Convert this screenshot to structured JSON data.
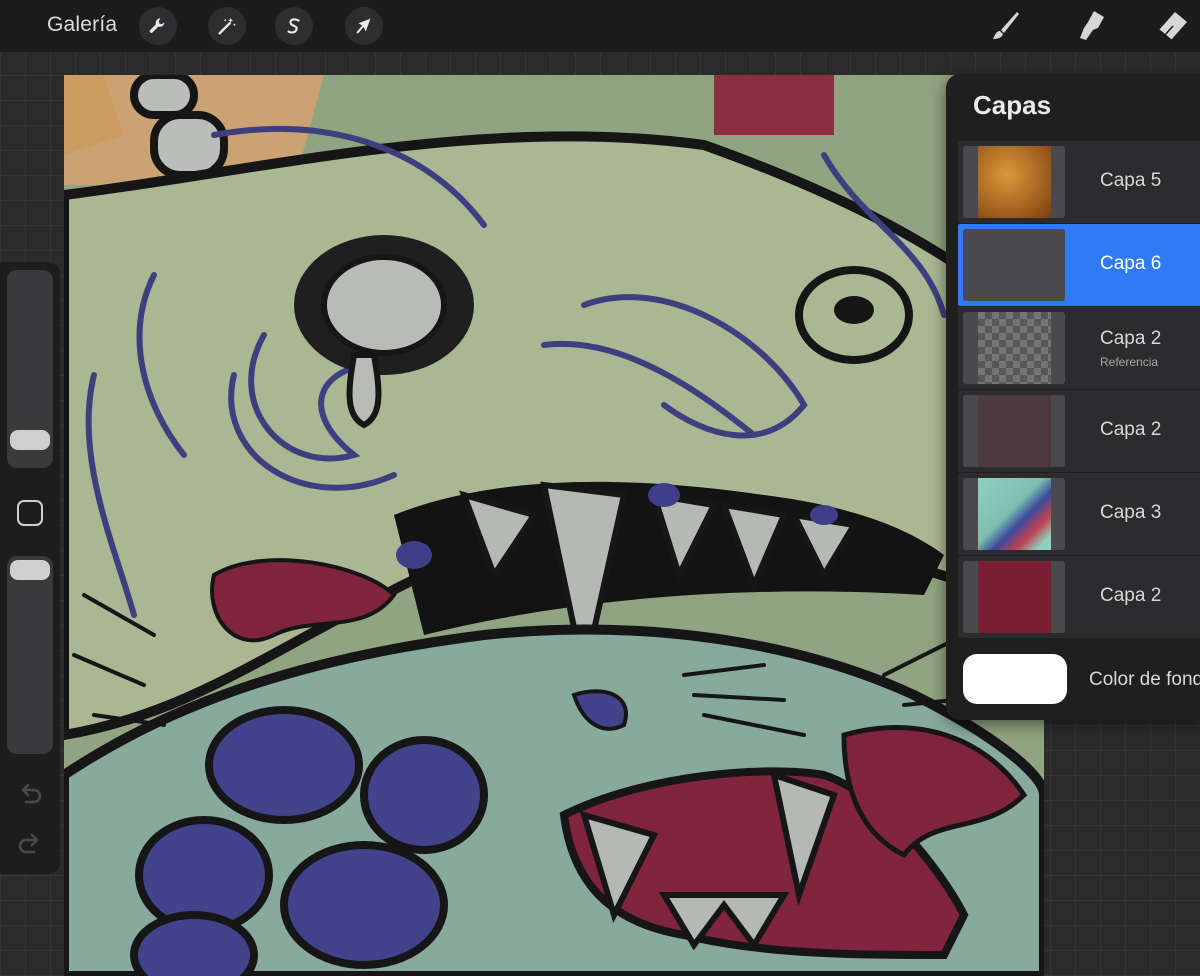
{
  "topbar": {
    "gallery_label": "Galería",
    "left_tools": [
      "wrench-icon",
      "magic-wand-icon",
      "selection-icon",
      "transform-arrow-icon"
    ],
    "right_tools": [
      "brush-icon",
      "smudge-icon",
      "eraser-icon"
    ]
  },
  "sidebar": {
    "size_slider_level": 0.2,
    "opacity_slider_level": 1.0,
    "icons": [
      "undo-icon",
      "redo-icon"
    ]
  },
  "layers_panel": {
    "title": "Capas",
    "layers": [
      {
        "name": "Capa 5",
        "subtitle": "",
        "selected": false
      },
      {
        "name": "Capa 6",
        "subtitle": "",
        "selected": true
      },
      {
        "name": "Capa 2",
        "subtitle": "Referencia",
        "selected": false
      },
      {
        "name": "Capa 2",
        "subtitle": "",
        "selected": false
      },
      {
        "name": "Capa 3",
        "subtitle": "",
        "selected": false
      },
      {
        "name": "Capa 2",
        "subtitle": "",
        "selected": false
      }
    ],
    "background_label": "Color de fondo",
    "background_color": "#ffffff"
  },
  "colors": {
    "selection_blue": "#2f7bf5",
    "toolbar": "#1c1c1d",
    "panel": "#1f1f20"
  }
}
